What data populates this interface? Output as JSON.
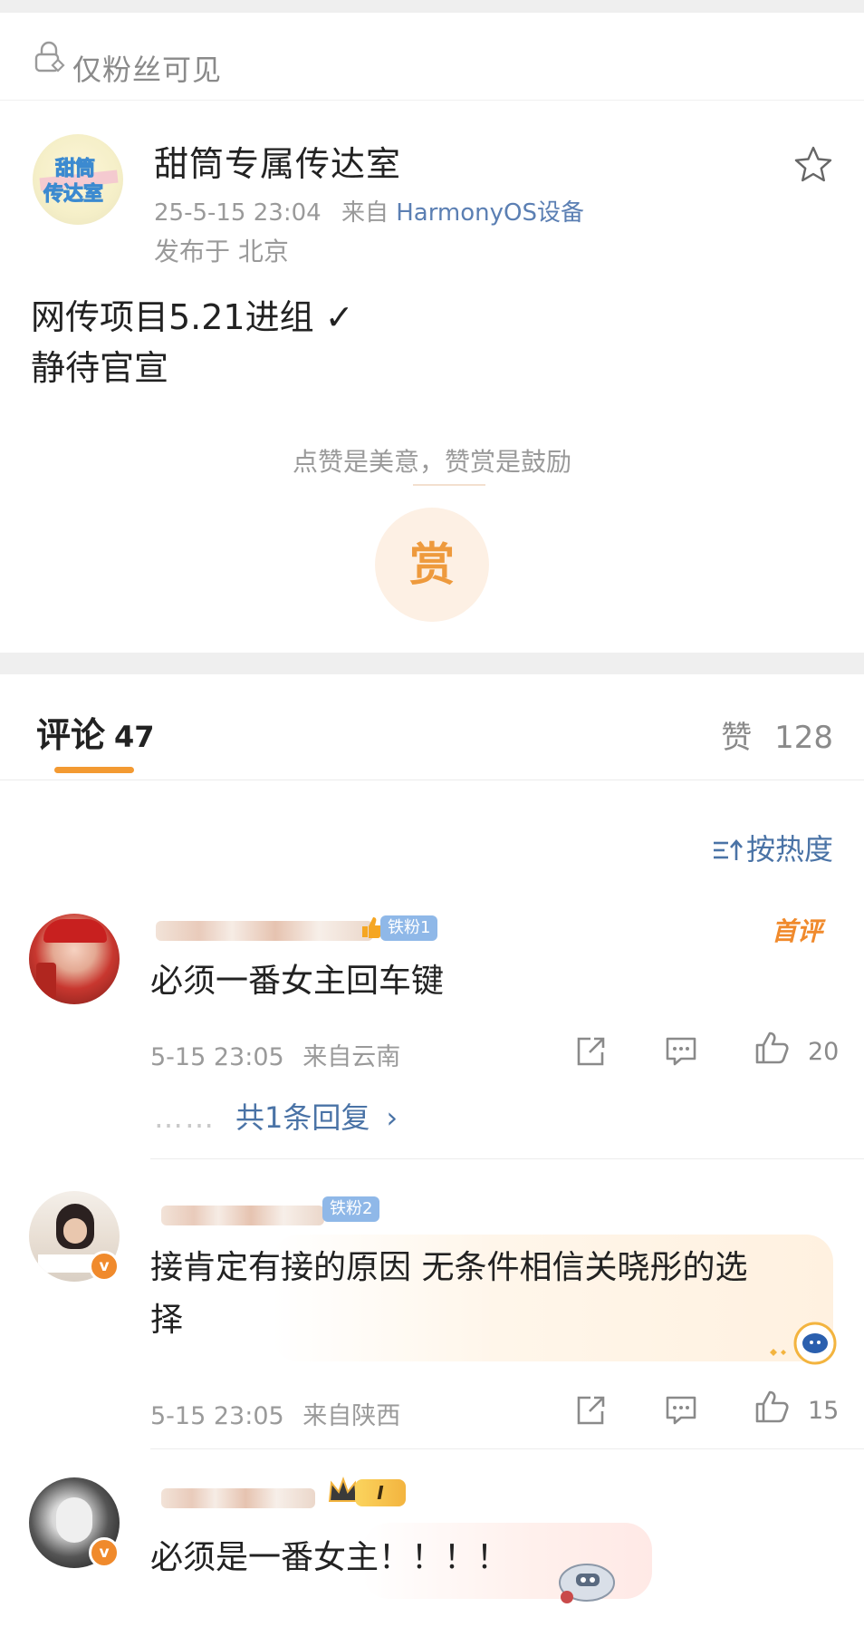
{
  "visibility": {
    "label": "仅粉丝可见",
    "icon": "lock-icon"
  },
  "post": {
    "author": "甜筒专属传达室",
    "avatar_text_line1": "甜筒",
    "avatar_text_line2": "传达室",
    "timestamp": "25-5-15 23:04",
    "source_prefix": "来自",
    "source_device": "HarmonyOS设备",
    "location": "发布于 北京",
    "content_line1": "网传项目5.21进组 ✓",
    "content_line2": "静待官宣"
  },
  "reward": {
    "tip": "点赞是美意，赞赏是鼓励",
    "button_label": "赏"
  },
  "tabs": {
    "comments_label": "评论",
    "comments_count": "47",
    "likes_label": "赞",
    "likes_count": "128"
  },
  "sort": {
    "label": "按热度"
  },
  "comments": [
    {
      "badge": "铁粉1",
      "first_tag": "首评",
      "text": "必须一番女主回车键",
      "time": "5-15 23:05",
      "from": "来自云南",
      "likes": "20",
      "reply_label": "共1条回复",
      "reply_dots": "……",
      "reply_chevron": "›"
    },
    {
      "badge": "铁粉2",
      "text_line1": "接肯定有接的原因 无条件相信关晓彤的选",
      "text_line2": "择",
      "time": "5-15 23:05",
      "from": "来自陕西",
      "likes": "15"
    },
    {
      "badge": "I",
      "text": "必须是一番女主！！！！"
    }
  ],
  "colors": {
    "accent": "#f39a32",
    "link": "#4a73a6",
    "badge": "#8fb8e8"
  }
}
